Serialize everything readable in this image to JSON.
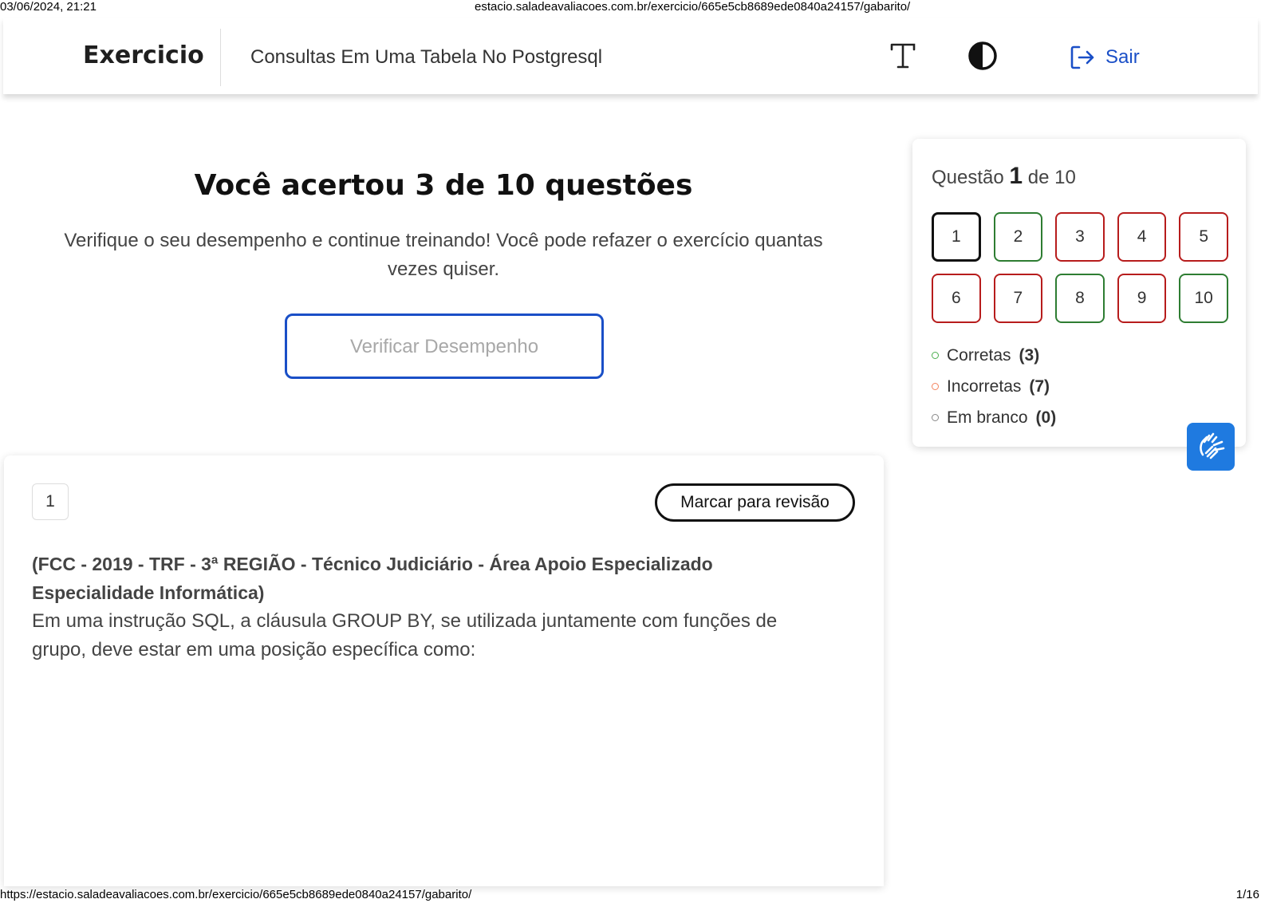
{
  "print": {
    "datetime": "03/06/2024, 21:21",
    "header_url": "estacio.saladeavaliacoes.com.br/exercicio/665e5cb8689ede0840a24157/gabarito/",
    "footer_url": "https://estacio.saladeavaliacoes.com.br/exercicio/665e5cb8689ede0840a24157/gabarito/",
    "page": "1/16"
  },
  "header": {
    "brand": "Exercicio",
    "subject": "Consultas Em Uma Tabela No Postgresql",
    "font_icon": "font-size-icon",
    "contrast_icon": "contrast-icon",
    "logout_icon": "logout-icon",
    "logout_label": "Sair"
  },
  "result": {
    "title": "Você acertou 3 de 10 questões",
    "description": "Verifique o seu desempenho e continue treinando! Você pode refazer o exercício quantas vezes quiser.",
    "button": "Verificar Desempenho"
  },
  "panel": {
    "counter_prefix": "Questão",
    "current": "1",
    "counter_suffix": "de 10",
    "questions": [
      {
        "label": "1",
        "status": "current"
      },
      {
        "label": "2",
        "status": "correct"
      },
      {
        "label": "3",
        "status": "incorrect"
      },
      {
        "label": "4",
        "status": "incorrect"
      },
      {
        "label": "5",
        "status": "incorrect"
      },
      {
        "label": "6",
        "status": "incorrect"
      },
      {
        "label": "7",
        "status": "incorrect"
      },
      {
        "label": "8",
        "status": "correct"
      },
      {
        "label": "9",
        "status": "incorrect"
      },
      {
        "label": "10",
        "status": "correct"
      }
    ],
    "legend": [
      {
        "label": "Corretas",
        "count": "(3)",
        "color": "#4caf50"
      },
      {
        "label": "Incorretas",
        "count": "(7)",
        "color": "#f4845f"
      },
      {
        "label": "Em branco",
        "count": "(0)",
        "color": "#888888"
      }
    ]
  },
  "accessibility": {
    "icon": "sign-language-icon",
    "color": "#1f7ae0"
  },
  "question": {
    "number": "1",
    "review_button": "Marcar para revisão",
    "source": "(FCC - 2019 - TRF - 3ª REGIÃO - Técnico Judiciário - Área Apoio Especializado Especialidade Informática)",
    "text": "Em uma instrução SQL, a cláusula GROUP BY, se utilizada juntamente com funções de grupo, deve estar em uma posição específica como:"
  },
  "colors": {
    "accent": "#1a4fc7",
    "correct": "#2e7d32",
    "incorrect": "#b71c1c"
  }
}
